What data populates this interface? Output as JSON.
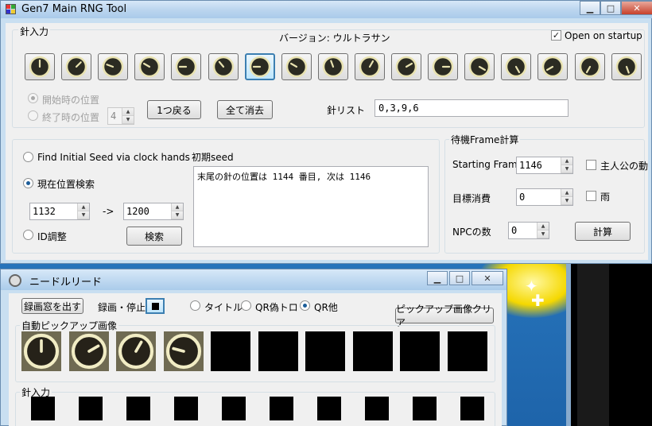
{
  "main": {
    "title": "Gen7 Main RNG Tool",
    "needle_input": {
      "label": "針入力",
      "version_label": "バージョン: ウルトラサン",
      "open_on_startup": "Open on startup",
      "clocks": [
        {
          "angle": 0,
          "selected": false
        },
        {
          "angle": 45,
          "selected": false
        },
        {
          "angle": 290,
          "selected": false
        },
        {
          "angle": 300,
          "selected": false
        },
        {
          "angle": 270,
          "selected": false
        },
        {
          "angle": 320,
          "selected": false
        },
        {
          "angle": 270,
          "selected": true
        },
        {
          "angle": 300,
          "selected": false
        },
        {
          "angle": 340,
          "selected": false
        },
        {
          "angle": 30,
          "selected": false
        },
        {
          "angle": 60,
          "selected": false
        },
        {
          "angle": 90,
          "selected": false
        },
        {
          "angle": 120,
          "selected": false
        },
        {
          "angle": 150,
          "selected": false
        },
        {
          "angle": 240,
          "selected": false
        },
        {
          "angle": 210,
          "selected": false
        },
        {
          "angle": 160,
          "selected": false
        }
      ],
      "start_position": "開始時の位置",
      "end_position": "終了時の位置",
      "end_position_value": "4",
      "back_button": "1つ戻る",
      "clear_all_button": "全て消去",
      "needle_list_label": "針リスト",
      "needle_list_value": "0,3,9,6"
    },
    "search": {
      "find_seed": "Find Initial Seed via clock hands",
      "current_position": "現在位置検索",
      "range_from": "1132",
      "range_arrow": "->",
      "range_to": "1200",
      "id_adjust": "ID調整",
      "search_button": "検索",
      "seed_label": "初期seed",
      "seed_result": "末尾の針の位置は 1144 番目, 次は 1146"
    },
    "frame_calc": {
      "label": "待機Frame計算",
      "starting_frame_label": "Starting Frame",
      "starting_frame_value": "1146",
      "target_consumption_label": "目標消費",
      "target_consumption_value": "0",
      "npc_label": "NPCの数",
      "npc_value": "0",
      "player_movement": "主人公の動き",
      "rain": "雨",
      "calc_button": "計算"
    }
  },
  "needle_reader": {
    "title": "ニードルリード",
    "show_recording_window": "録画窓を出す",
    "record_stop": "録画・停止",
    "mode_title": "タイトル",
    "mode_qr_fake": "QR偽トロ",
    "mode_qr_other": "QR他",
    "clear_pickup_button": "ピックアップ画像クリア",
    "auto_pickup_label": "自動ピックアップ画像",
    "pickup_angles": [
      0,
      60,
      30,
      285
    ],
    "needle_input_label": "針入力"
  },
  "colors": {
    "accent": "#3c7fb1",
    "clock_face": "#2b2b22",
    "clock_rim": "#e8e2b0"
  }
}
